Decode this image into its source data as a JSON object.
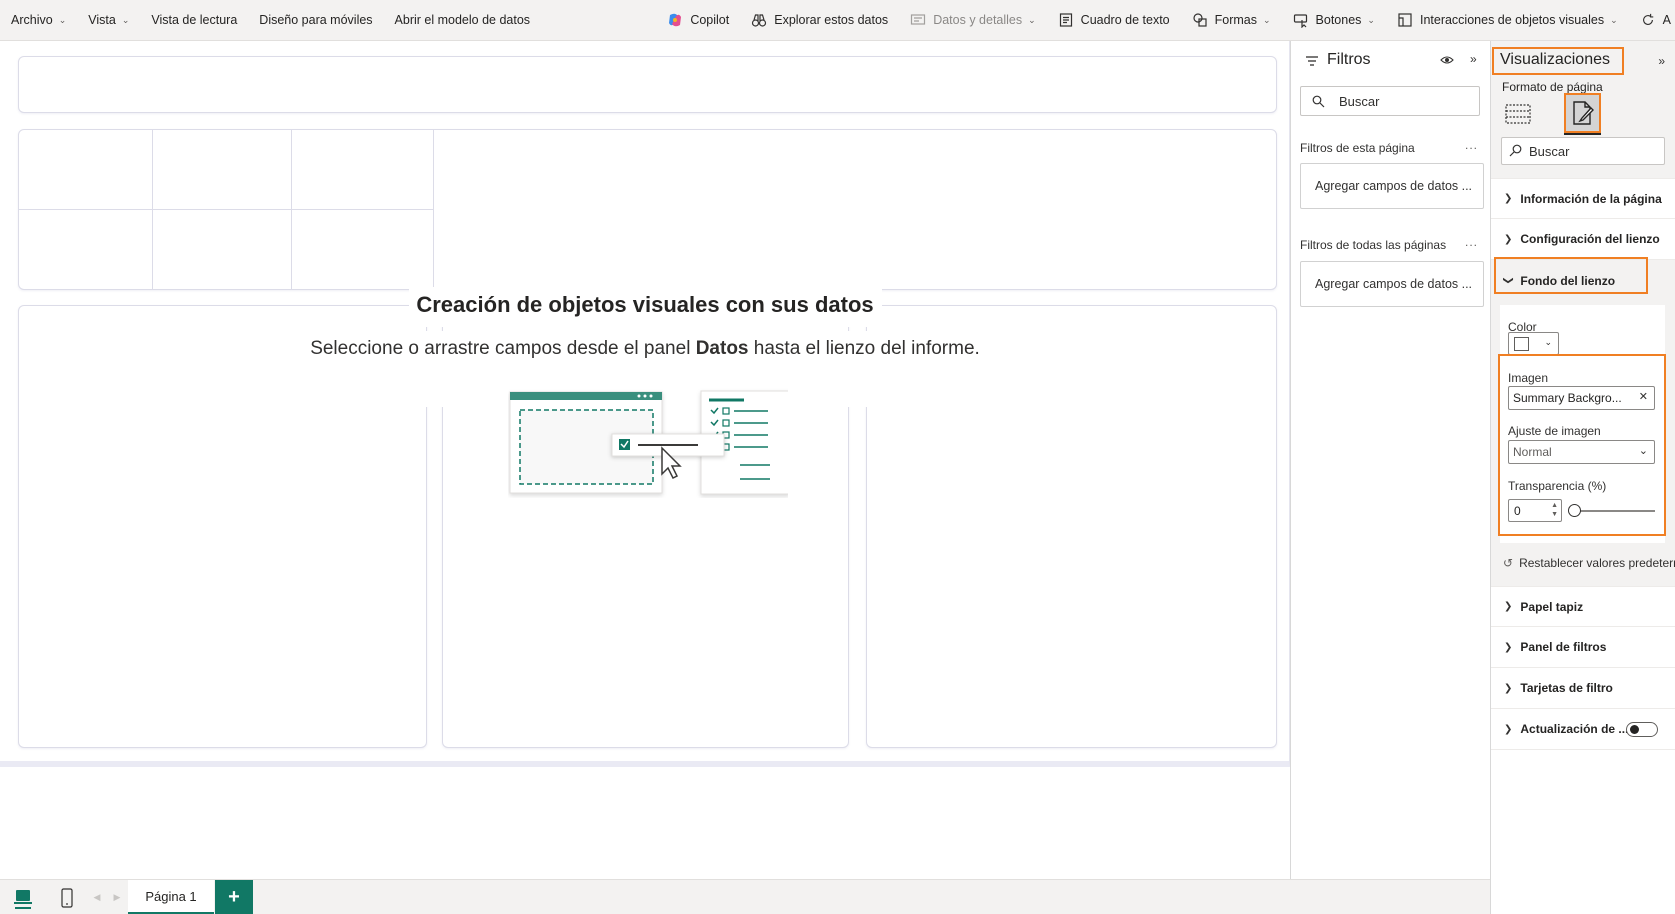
{
  "ribbon": {
    "archivo": "Archivo",
    "vista": "Vista",
    "vista_lectura": "Vista de lectura",
    "diseno_moviles": "Diseño para móviles",
    "abrir_modelo": "Abrir el modelo de datos",
    "copilot": "Copilot",
    "explorar": "Explorar estos datos",
    "datos_detalles": "Datos y detalles",
    "cuadro_texto": "Cuadro de texto",
    "formas": "Formas",
    "botones": "Botones",
    "interacciones": "Interacciones de objetos visuales",
    "overflow": "A"
  },
  "canvas": {
    "empty_title": "Creación de objetos visuales con sus datos",
    "empty_sub_pre": "Seleccione o arrastre campos desde el panel ",
    "empty_sub_bold": "Datos",
    "empty_sub_post": " hasta el lienzo del informe."
  },
  "pages": {
    "tab_label": "Página 1",
    "add_label": "+"
  },
  "filters": {
    "title": "Filtros",
    "search_placeholder": "Buscar",
    "this_page_label": "Filtros de esta página",
    "all_pages_label": "Filtros de todas las páginas",
    "add_fields_1": "Agregar campos de datos ...",
    "add_fields_2": "Agregar campos de datos ...",
    "more": "..."
  },
  "visualizations": {
    "title": "Visualizaciones",
    "subtitle": "Formato de página",
    "search_placeholder": "Buscar",
    "cards": {
      "info_pagina": "Información de la página",
      "config_lienzo": "Configuración del lienzo",
      "fondo_lienzo": "Fondo del lienzo",
      "papel_tapiz": "Papel tapiz",
      "panel_filtros": "Panel de filtros",
      "tarjetas_filtro": "Tarjetas de filtro",
      "actualizacion": "Actualización de ..."
    },
    "fondo": {
      "color_label": "Color",
      "imagen_label": "Imagen",
      "imagen_value": "Summary Backgro...",
      "ajuste_label": "Ajuste de imagen",
      "ajuste_value": "Normal",
      "transparencia_label": "Transparencia (%)",
      "transparencia_value": "0",
      "reset_label": "Restablecer valores predetermi"
    }
  },
  "colors": {
    "accent": "#117865",
    "highlight": "#f07f23"
  }
}
